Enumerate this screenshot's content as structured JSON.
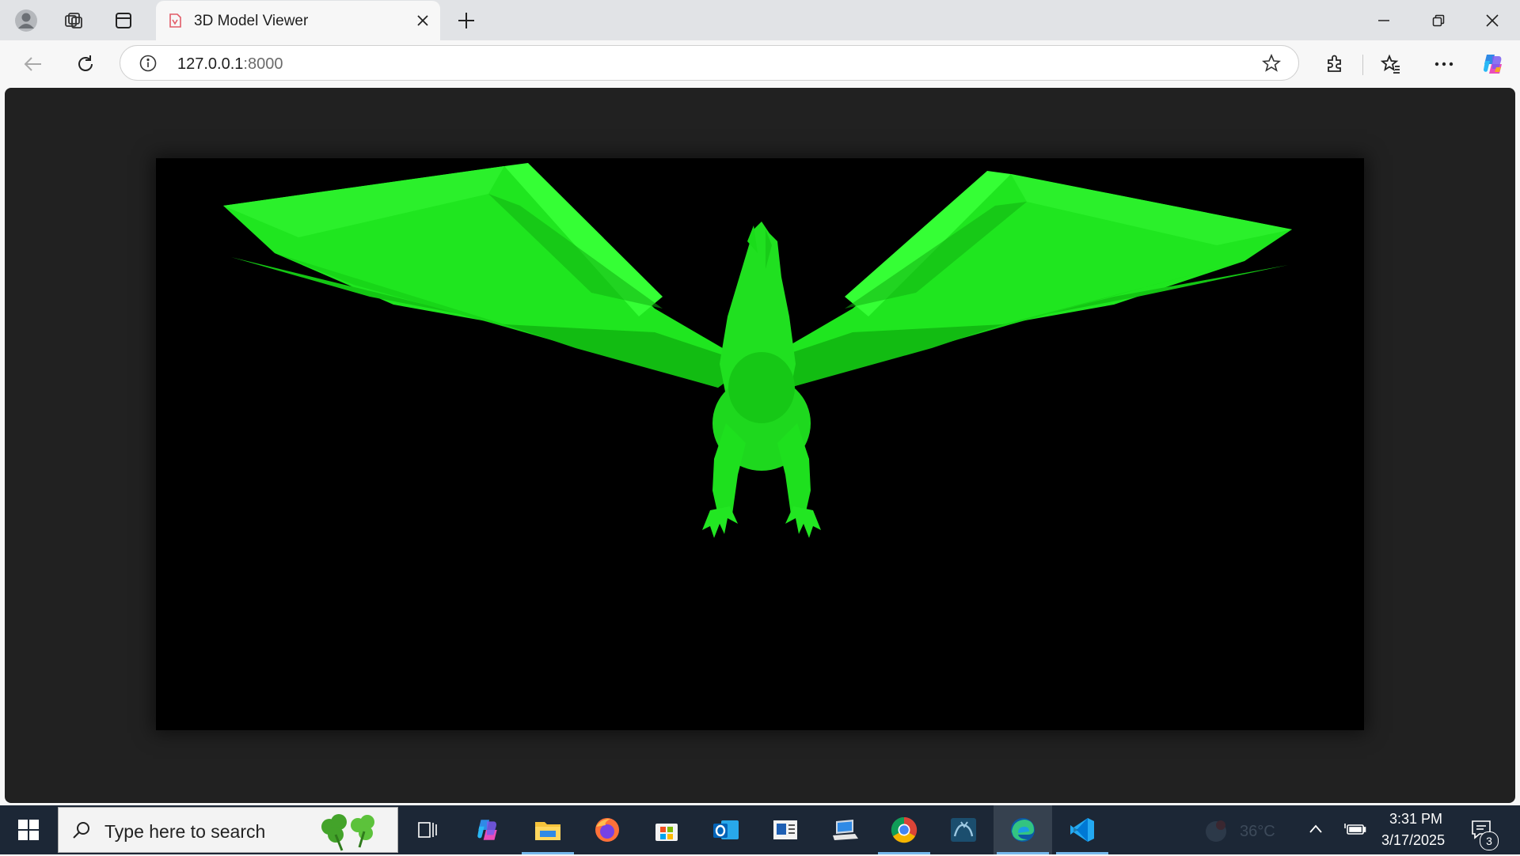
{
  "browser": {
    "tab_title": "3D Model Viewer",
    "url_host": "127.0.0.1",
    "url_port": ":8000"
  },
  "taskbar": {
    "search_placeholder": "Type here to search",
    "weather_temp": "36°C",
    "time": "3:31 PM",
    "date": "3/17/2025",
    "notification_count": "3",
    "apps": [
      "task-view",
      "copilot",
      "file-explorer",
      "firefox",
      "microsoft-store",
      "outlook",
      "news",
      "remote-desktop",
      "chrome",
      "mysql-workbench",
      "edge",
      "vscode"
    ]
  },
  "viewer": {
    "model": "dragon",
    "model_color": "#00ff00",
    "background": "#000000"
  }
}
